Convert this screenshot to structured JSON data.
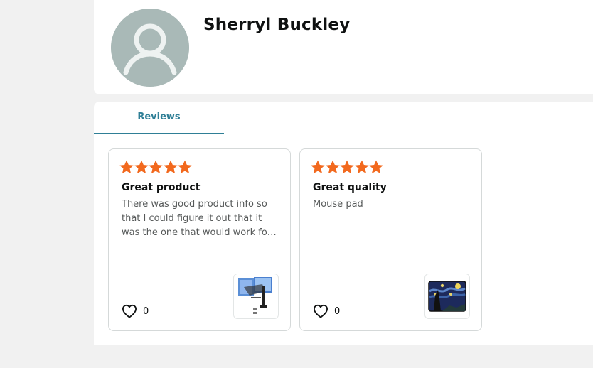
{
  "profile": {
    "name": "Sherryl Buckley",
    "avatar_icon": "user-silhouette-icon"
  },
  "tabs": [
    {
      "label": "Reviews",
      "active": true
    }
  ],
  "reviews": [
    {
      "rating": 5,
      "title": "Great product",
      "body": "There was good product info so that I could figure it out that it was the one that would work for my needs.",
      "likes": "0",
      "thumbnail_icon": "monitor-arm-mount-icon"
    },
    {
      "rating": 5,
      "title": "Great quality",
      "body": "Mouse pad",
      "likes": "0",
      "thumbnail_icon": "starry-night-mouse-pad-icon"
    }
  ],
  "colors": {
    "star": "#f2691e",
    "accent": "#2f7f96",
    "avatar_bg": "#a9b9b7"
  }
}
